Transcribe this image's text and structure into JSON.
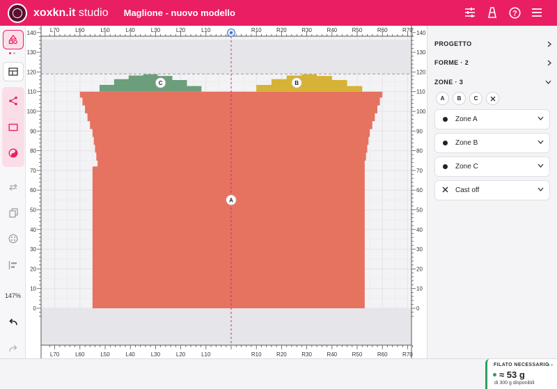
{
  "header": {
    "brand": "xoxkn.it",
    "brand_suffix": "studio",
    "title": "Maglione - nuovo modello",
    "icons": [
      "sliders-icon",
      "cone-icon",
      "help-icon",
      "menu-icon"
    ]
  },
  "toolbar": {
    "tools": [
      "shapes-icon",
      "layout-icon",
      "share-nodes-icon",
      "rectangle-icon",
      "yin-yang-icon",
      "swap-icon",
      "copy-icon",
      "dots-circle-icon",
      "align-left-icon",
      "undo-icon",
      "redo-icon"
    ],
    "zoom": "147%"
  },
  "canvas": {
    "x_ticks": [
      "L70",
      "L60",
      "L50",
      "L40",
      "L30",
      "L20",
      "L10",
      "R10",
      "R20",
      "R30",
      "R40",
      "R50",
      "R60",
      "R70"
    ],
    "y_ticks": [
      "0",
      "10",
      "20",
      "30",
      "40",
      "50",
      "60",
      "70",
      "80",
      "90",
      "100",
      "110",
      "120",
      "130",
      "140"
    ],
    "zone_labels": [
      "A",
      "B",
      "C"
    ],
    "colors": {
      "zone_a": "#e57360",
      "zone_b": "#d6b236",
      "zone_c": "#6d9e7b",
      "guide": "#c0326a"
    }
  },
  "panel": {
    "progetto": "PROGETTO",
    "forme": "FORME · 2",
    "zone": "ZONE · 3",
    "chips": [
      "A",
      "B",
      "C"
    ],
    "zones": [
      "Zone A",
      "Zone B",
      "Zone C"
    ],
    "cast_off": "Cast off"
  },
  "footer": {
    "label": "FILATO NECESSARIO",
    "amount": "≈ 53 g",
    "available": "di 300 g disponibili"
  }
}
